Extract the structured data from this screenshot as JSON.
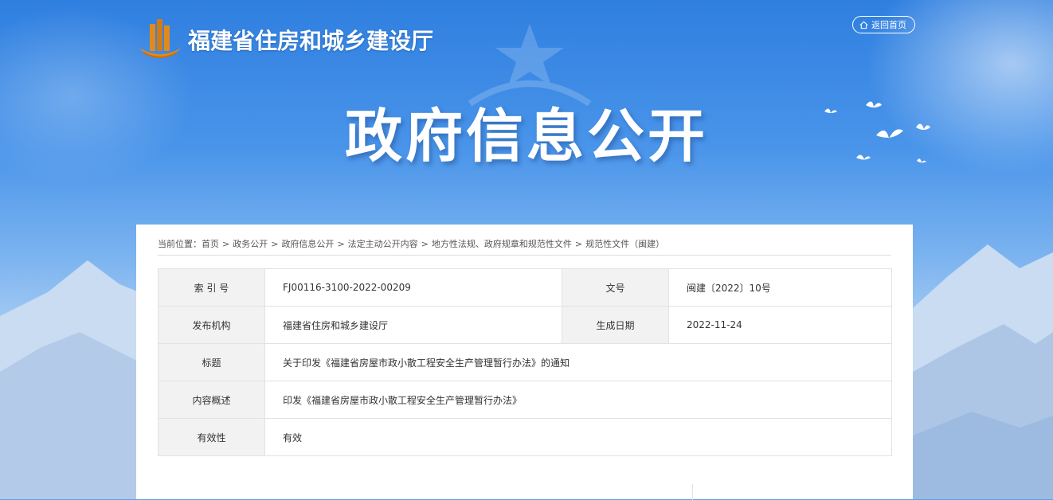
{
  "header": {
    "site_title": "福建省住房和城乡建设厅",
    "home_button": "返回首页",
    "banner_title": "政府信息公开"
  },
  "breadcrumb": {
    "prefix": "当前位置：",
    "items": [
      "首页",
      "政务公开",
      "政府信息公开",
      "法定主动公开内容",
      "地方性法规、政府规章和规范性文件",
      "规范性文件（闽建）"
    ]
  },
  "info_table": {
    "index_label": "索 引 号",
    "index_value": "FJ00116-3100-2022-00209",
    "doc_no_label": "文号",
    "doc_no_value": "闽建〔2022〕10号",
    "publisher_label": "发布机构",
    "publisher_value": "福建省住房和城乡建设厅",
    "date_label": "生成日期",
    "date_value": "2022-11-24",
    "title_label": "标题",
    "title_value": "关于印发《福建省房屋市政小散工程安全生产管理暂行办法》的通知",
    "summary_label": "内容概述",
    "summary_value": "印发《福建省房屋市政小散工程安全生产管理暂行办法》",
    "validity_label": "有效性",
    "validity_value": "有效"
  },
  "icons": {
    "logo": "building-pillars-logo",
    "home": "home-icon",
    "decoration": "doves-icon"
  },
  "colors": {
    "sky_top": "#2f7fe0",
    "sky_bottom": "#d9e8f8",
    "logo_orange": "#e08a1e",
    "label_bg": "#f2f2f2"
  }
}
